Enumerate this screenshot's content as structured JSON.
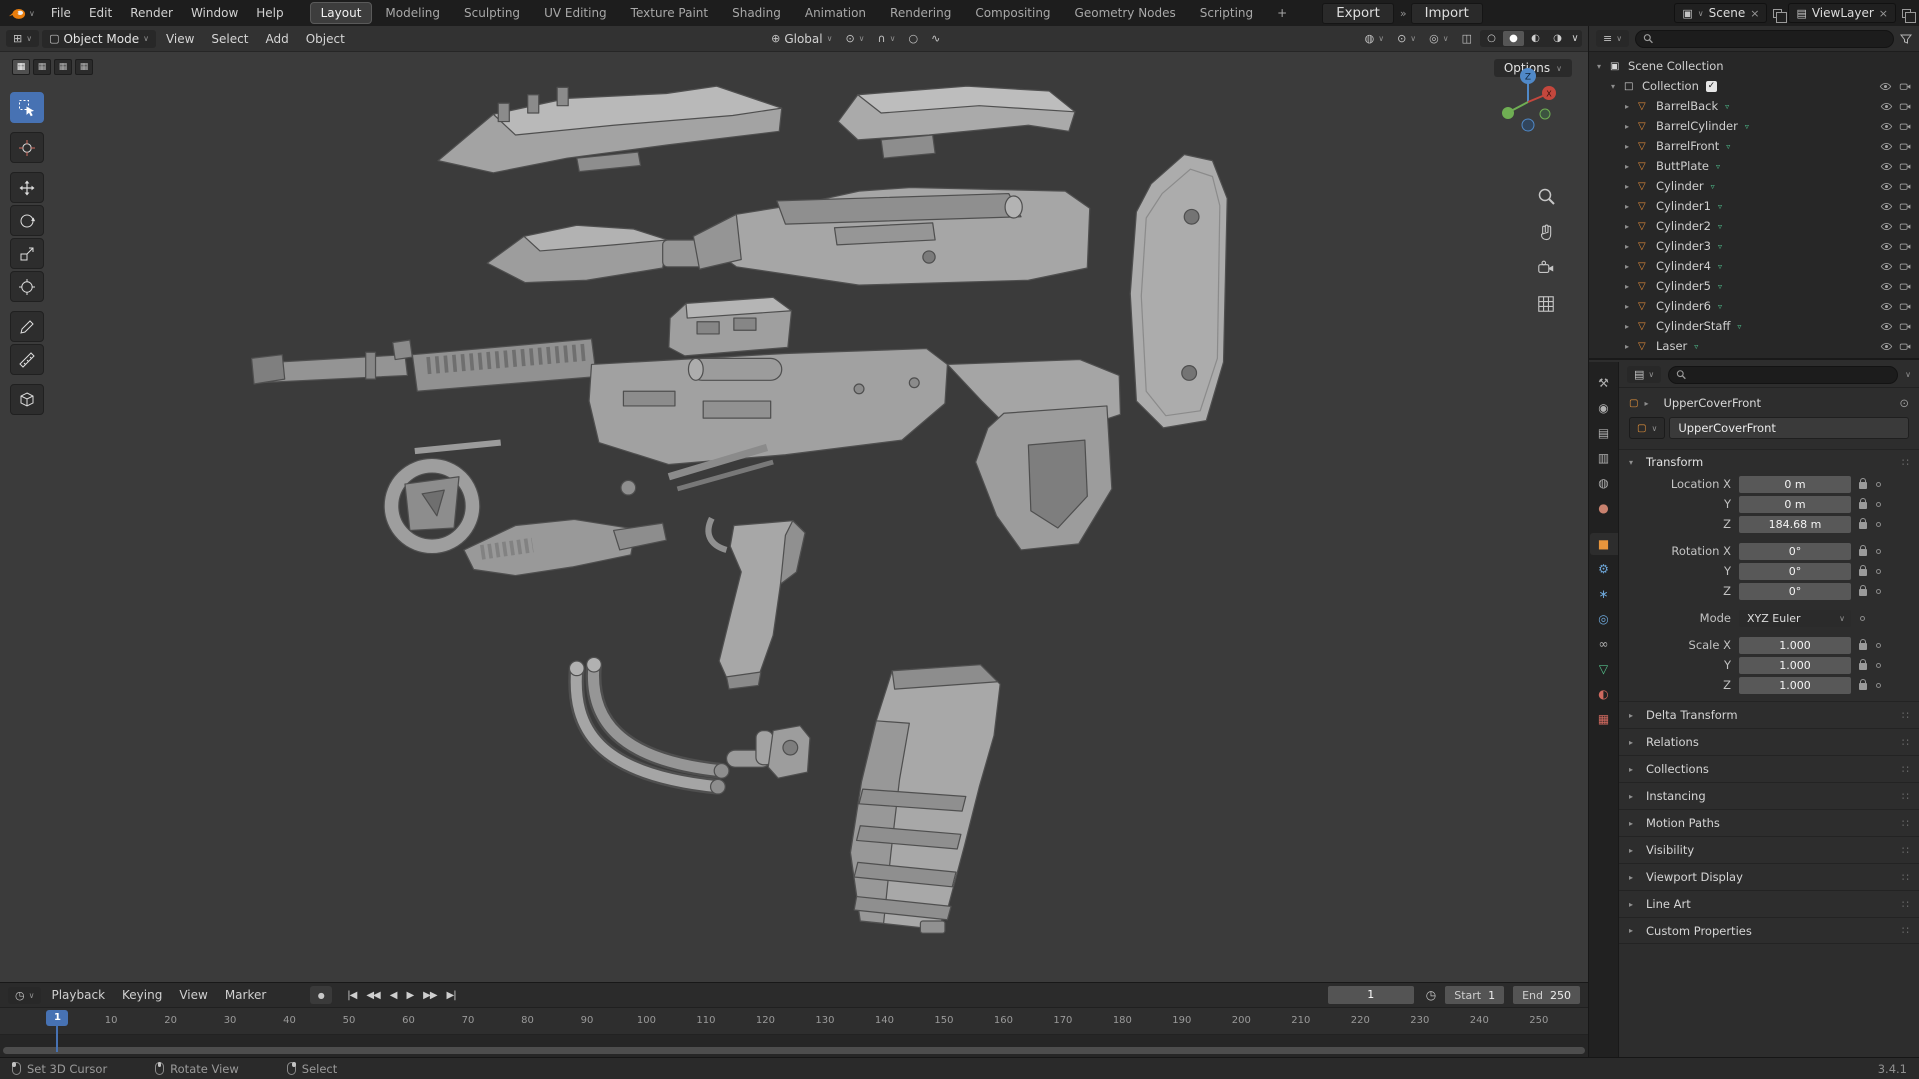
{
  "colors": {
    "accent": "#4772b3",
    "object_orange": "#e8953c",
    "mesh_orange": "#de8a3a",
    "data_green": "#4ebe8c",
    "axis_x": "#c4473d",
    "axis_y": "#6fae53",
    "axis_z": "#5089c8"
  },
  "icons": {
    "dropdown": "∨",
    "expanded": "▾",
    "collapsed": "▸",
    "drag_dots": "∷",
    "close": "×",
    "chevrons": "»",
    "editor_3dview": "⊞",
    "editor_outliner": "≡",
    "editor_properties": "▤",
    "editor_timeline": "◷",
    "object_mode": "▢",
    "global_orientation": "⊕",
    "snap_magnet": "∩",
    "proportional": "○",
    "falloff": "∿",
    "visibility": "◍",
    "gizmo_toggle": "⊙",
    "overlays": "◎",
    "xray": "◫",
    "wireframe": "○",
    "solid": "●",
    "material_preview": "◐",
    "rendered": "◑",
    "select_mode": "▦",
    "mesh_object": "▽",
    "mesh_data": "▿",
    "scene_collection": "▣",
    "collection": "□",
    "check": "✓",
    "pin": "⊙",
    "record": "●",
    "jump_start": "|◀",
    "prev_key": "◀◀",
    "play_rev": "◀",
    "play": "▶",
    "next_key": "▶▶",
    "jump_end": "▶|",
    "stopwatch": "◷"
  },
  "topbar": {
    "menus": [
      "File",
      "Edit",
      "Render",
      "Window",
      "Help"
    ],
    "workspaces": [
      "Layout",
      "Modeling",
      "Sculpting",
      "UV Editing",
      "Texture Paint",
      "Shading",
      "Animation",
      "Rendering",
      "Compositing",
      "Geometry Nodes",
      "Scripting"
    ],
    "active_workspace": "Layout",
    "add_tab": "+",
    "export_button": "Export",
    "import_button": "Import",
    "scene_name": "Scene",
    "viewlayer_name": "ViewLayer"
  },
  "viewport": {
    "mode_select": "Object Mode",
    "menus": [
      "View",
      "Select",
      "Add",
      "Object"
    ],
    "orientation": "Global",
    "options_button": "Options",
    "gizmo": {
      "z": "Z",
      "x": "X"
    }
  },
  "outliner": {
    "scene_collection": "Scene Collection",
    "collection": "Collection",
    "items": [
      "BarrelBack",
      "BarrelCylinder",
      "BarrelFront",
      "ButtPlate",
      "Cylinder",
      "Cylinder1",
      "Cylinder2",
      "Cylinder3",
      "Cylinder4",
      "Cylinder5",
      "Cylinder6",
      "CylinderStaff",
      "Laser"
    ]
  },
  "properties": {
    "breadcrumb_object": "UpperCoverFront",
    "name_field": "UpperCoverFront",
    "tabs": [
      {
        "name": "tool",
        "glyph": "⚒",
        "color": "#b0b0b0",
        "active": false
      },
      {
        "name": "render",
        "glyph": "◉",
        "color": "#b0b0b0",
        "active": false
      },
      {
        "name": "output",
        "glyph": "▤",
        "color": "#b0b0b0",
        "active": false
      },
      {
        "name": "view-layer",
        "glyph": "▥",
        "color": "#b0b0b0",
        "active": false
      },
      {
        "name": "scene",
        "glyph": "◍",
        "color": "#b0b0b0",
        "active": false
      },
      {
        "name": "world",
        "glyph": "●",
        "color": "#c9826f",
        "active": false
      },
      {
        "name": "object",
        "glyph": "■",
        "color": "#e8953c",
        "active": true
      },
      {
        "name": "modifiers",
        "glyph": "⚙",
        "color": "#6ea7d9",
        "active": false
      },
      {
        "name": "particles",
        "glyph": "∗",
        "color": "#6ea7d9",
        "active": false
      },
      {
        "name": "physics",
        "glyph": "◎",
        "color": "#6ea7d9",
        "active": false
      },
      {
        "name": "constraints",
        "glyph": "∞",
        "color": "#b0b0b0",
        "active": false
      },
      {
        "name": "object-data",
        "glyph": "▽",
        "color": "#55c08a",
        "active": false
      },
      {
        "name": "material",
        "glyph": "◐",
        "color": "#d0695f",
        "active": false
      },
      {
        "name": "texture",
        "glyph": "▦",
        "color": "#d0695f",
        "active": false
      }
    ],
    "transform": {
      "title": "Transform",
      "rows": [
        {
          "label": "Location X",
          "value": "0 m"
        },
        {
          "label": "Y",
          "value": "0 m"
        },
        {
          "label": "Z",
          "value": "184.68 m"
        },
        {
          "label": "Rotation X",
          "value": "0°"
        },
        {
          "label": "Y",
          "value": "0°"
        },
        {
          "label": "Z",
          "value": "0°"
        },
        {
          "label": "Mode",
          "value": "XYZ Euler"
        },
        {
          "label": "Scale X",
          "value": "1.000"
        },
        {
          "label": "Y",
          "value": "1.000"
        },
        {
          "label": "Z",
          "value": "1.000"
        }
      ]
    },
    "sections": [
      "Delta Transform",
      "Relations",
      "Collections",
      "Instancing",
      "Motion Paths",
      "Visibility",
      "Viewport Display",
      "Line Art",
      "Custom Properties"
    ]
  },
  "timeline": {
    "menus": [
      "Playback",
      "Keying",
      "View",
      "Marker"
    ],
    "current_frame": "1",
    "start_label": "Start",
    "start_value": "1",
    "end_label": "End",
    "end_value": "250",
    "ticks": [
      10,
      20,
      30,
      40,
      50,
      60,
      70,
      80,
      90,
      100,
      110,
      120,
      130,
      140,
      150,
      160,
      170,
      180,
      190,
      200,
      210,
      220,
      230,
      240,
      250
    ]
  },
  "statusbar": {
    "hints": [
      "Set 3D Cursor",
      "Rotate View",
      "Select"
    ],
    "version": "3.4.1"
  }
}
